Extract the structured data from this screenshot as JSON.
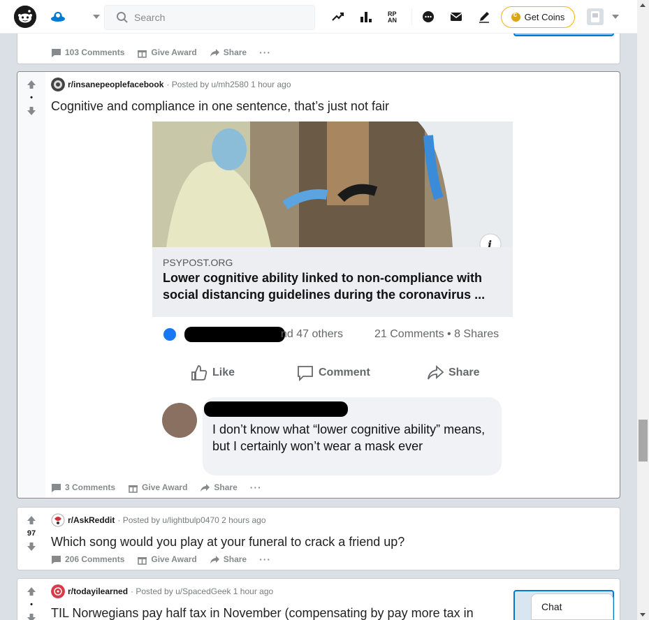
{
  "header": {
    "search_placeholder": "Search",
    "get_coins_label": "Get Coins"
  },
  "colors": {
    "accent": "#0079d3",
    "coins_border": "#ffb000",
    "page_bg": "#dae0e6"
  },
  "posts": [
    {
      "actions": {
        "comments": "103 Comments",
        "award": "Give Award",
        "share": "Share",
        "more": "···"
      }
    },
    {
      "subreddit": "r/insanepeoplefacebook",
      "posted_by": "· Posted by u/mh2580 1 hour ago",
      "score": "•",
      "title": "Cognitive and compliance in one sentence, that’s just not fair",
      "image": {
        "domain": "PSYPOST.ORG",
        "headline": "Lower cognitive ability linked to non-compliance with social distancing guidelines during the coronavirus ...",
        "others": "nd 47 others",
        "counts": "21 Comments • 8 Shares",
        "like": "Like",
        "comment": "Comment",
        "share": "Share",
        "comment_text": "I don’t know what “lower cognitive ability” means, but I certainly won’t wear a mask ever"
      },
      "actions": {
        "comments": "3 Comments",
        "award": "Give Award",
        "share": "Share",
        "more": "···"
      }
    },
    {
      "subreddit": "r/AskReddit",
      "posted_by": "· Posted by u/lightbulp0470 2 hours ago",
      "score": "97",
      "title": "Which song would you play at your funeral to crack a friend up?",
      "actions": {
        "comments": "206 Comments",
        "award": "Give Award",
        "share": "Share",
        "more": "···"
      }
    },
    {
      "subreddit": "r/todayilearned",
      "posted_by": "· Posted by u/SpacedGeek 1 hour ago",
      "score": "•",
      "title": "TIL Norwegians pay half tax in November (compensating by pay more tax in"
    }
  ],
  "chat": {
    "label": "Chat"
  }
}
